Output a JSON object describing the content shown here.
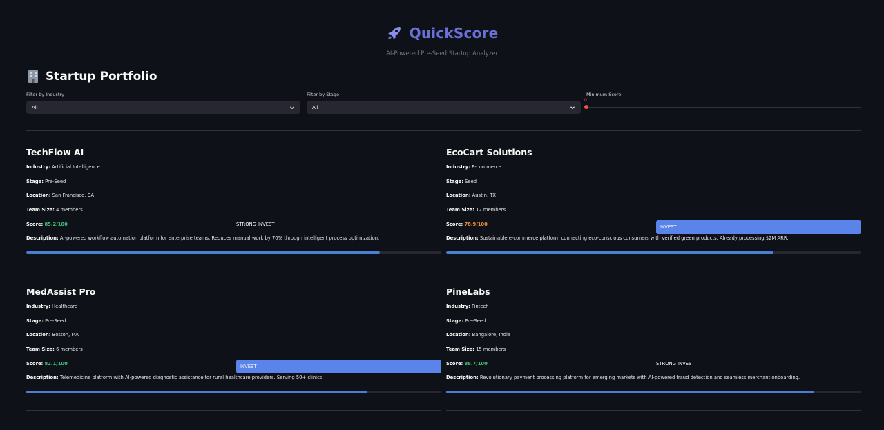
{
  "app": {
    "title": "QuickScore",
    "subtitle": "AI-Powered Pre-Seed Startup Analyzer"
  },
  "section": {
    "title": "Startup Portfolio"
  },
  "filters": {
    "industry": {
      "label": "Filter by Industry",
      "value": "All"
    },
    "stage": {
      "label": "Filter by Stage",
      "value": "All"
    },
    "min_score": {
      "label": "Minimum Score",
      "value": "0"
    }
  },
  "labels": {
    "industry": "Industry:",
    "stage": "Stage:",
    "location": "Location:",
    "team_size": "Team Size:",
    "score": "Score:",
    "description": "Description:"
  },
  "colors": {
    "accent": "#6c6fd6",
    "slider": "#ff4b4b",
    "score_green": "#3fbf73",
    "score_orange": "#e8923a",
    "invest_button": "#5b84ea",
    "progress": "#4a7fd6"
  },
  "startups": [
    {
      "name": "TechFlow AI",
      "industry": "Artificial Intelligence",
      "stage": "Pre-Seed",
      "location": "San Francisco, CA",
      "team_size": "4 members",
      "score": "85.2/100",
      "score_fraction": 0.852,
      "score_color": "#3fbf73",
      "recommendation": "STRONG INVEST",
      "description": "AI-powered workflow automation platform for enterprise teams. Reduces manual work by 70% through intelligent process optimization."
    },
    {
      "name": "EcoCart Solutions",
      "industry": "E-commerce",
      "stage": "Seed",
      "location": "Austin, TX",
      "team_size": "12 members",
      "score": "78.9/100",
      "score_fraction": 0.789,
      "score_color": "#e8923a",
      "recommendation": "INVEST",
      "description": "Sustainable e-commerce platform connecting eco-conscious consumers with verified green products. Already processing $2M ARR."
    },
    {
      "name": "MedAssist Pro",
      "industry": "Healthcare",
      "stage": "Pre-Seed",
      "location": "Boston, MA",
      "team_size": "6 members",
      "score": "82.1/100",
      "score_fraction": 0.821,
      "score_color": "#3fbf73",
      "recommendation": "INVEST",
      "description": "Telemedicine platform with AI-powered diagnostic assistance for rural healthcare providers. Serving 50+ clinics."
    },
    {
      "name": "PineLabs",
      "industry": "Fintech",
      "stage": "Pre-Seed",
      "location": "Bangalore, India",
      "team_size": "15 members",
      "score": "88.7/100",
      "score_fraction": 0.887,
      "score_color": "#3fbf73",
      "recommendation": "STRONG INVEST",
      "description": "Revolutionary payment processing platform for emerging markets with AI-powered fraud detection and seamless merchant onboarding."
    }
  ]
}
